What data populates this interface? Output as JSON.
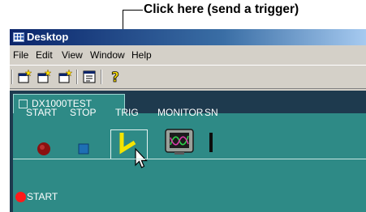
{
  "annotation": {
    "callout": "Click here (send a trigger)"
  },
  "window": {
    "title": "Desktop"
  },
  "menu": [
    "File",
    "Edit",
    "View",
    "Window",
    "Help"
  ],
  "toolbar": {
    "icons": [
      "new-window-icon",
      "new-window-alt-icon",
      "open-window-icon",
      "properties-icon",
      "help-icon"
    ]
  },
  "tab": {
    "label": "DX1000TEST"
  },
  "commands": [
    {
      "label": "START",
      "icon": "start-icon"
    },
    {
      "label": "STOP",
      "icon": "stop-icon"
    },
    {
      "label": "TRIG",
      "icon": "trigger-icon"
    },
    {
      "label": "MONITOR",
      "icon": "monitor-icon"
    },
    {
      "label": "SN",
      "icon": "snapshot-icon"
    }
  ],
  "status": {
    "text": "START"
  },
  "colors": {
    "panel": "#2e8a86",
    "background": "#1e3a4e",
    "start": "#8b1010",
    "stop": "#1e6fb4",
    "trigger": "#f4e400",
    "status_dot": "#ff1a1a"
  }
}
